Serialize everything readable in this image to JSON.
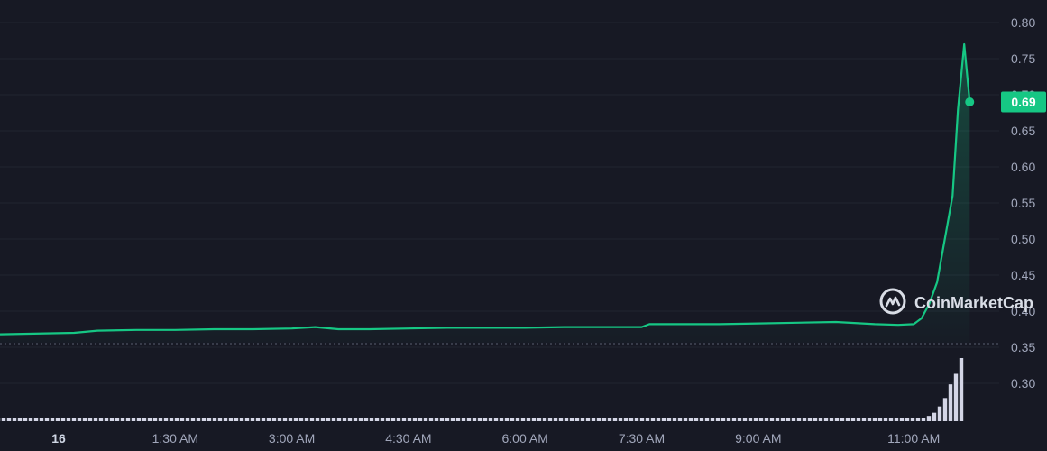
{
  "chart_data": {
    "type": "line",
    "y_ticks": [
      "0.80",
      "0.75",
      "0.70",
      "0.65",
      "0.60",
      "0.55",
      "0.50",
      "0.45",
      "0.40",
      "0.35",
      "0.30"
    ],
    "ylim": [
      0.25,
      0.82
    ],
    "x_ticks": [
      "16",
      "1:30 AM",
      "3:00 AM",
      "4:30 AM",
      "6:00 AM",
      "7:30 AM",
      "9:00 AM",
      "11:00 AM"
    ],
    "x_tick_hours": [
      0,
      1.5,
      3,
      4.5,
      6,
      7.5,
      9,
      11
    ],
    "series": [
      {
        "hours": [
          0,
          0.2,
          0.5,
          1,
          1.5,
          2,
          2.5,
          3,
          3.3,
          3.6,
          4,
          4.5,
          5,
          5.5,
          6,
          6.5,
          7,
          7.5,
          7.6,
          8,
          8.5,
          9,
          9.5,
          10,
          10.5,
          10.8,
          11,
          11.1,
          11.2,
          11.3,
          11.4,
          11.5,
          11.57,
          11.65,
          11.72
        ],
        "values": [
          0.368,
          0.37,
          0.373,
          0.374,
          0.374,
          0.375,
          0.375,
          0.376,
          0.378,
          0.375,
          0.375,
          0.376,
          0.377,
          0.377,
          0.377,
          0.378,
          0.378,
          0.378,
          0.382,
          0.382,
          0.382,
          0.383,
          0.384,
          0.385,
          0.382,
          0.381,
          0.382,
          0.39,
          0.41,
          0.44,
          0.5,
          0.56,
          0.68,
          0.77,
          0.69
        ]
      }
    ],
    "volume": [
      1,
      1,
      1,
      1,
      1,
      1,
      1,
      1,
      1,
      1,
      1,
      1,
      1,
      1,
      1,
      1,
      1,
      1,
      1,
      1,
      1,
      1,
      1,
      1,
      1,
      1,
      1,
      1,
      1,
      1,
      1,
      1,
      1,
      1,
      1,
      1,
      1,
      1,
      1,
      1,
      1,
      1,
      1,
      1,
      1,
      1,
      1,
      1,
      1,
      1,
      1,
      1,
      1,
      1,
      1,
      1,
      1,
      1,
      1,
      1,
      1,
      1,
      1,
      1,
      1,
      1,
      1,
      1,
      1,
      1,
      1,
      1,
      1,
      1,
      1,
      1,
      1,
      1,
      1,
      1,
      1,
      1,
      1,
      1,
      1,
      1,
      1,
      1,
      1,
      1,
      1,
      1,
      1,
      1,
      1,
      1,
      1,
      1,
      1,
      1,
      1,
      1,
      1,
      1,
      1,
      1,
      1,
      1,
      1,
      1,
      1,
      1,
      1,
      1,
      1,
      1,
      1,
      1,
      1,
      1,
      1,
      1,
      1,
      1,
      1,
      1,
      1,
      1,
      1,
      1,
      1,
      1,
      1,
      1,
      1,
      1,
      1,
      1,
      1,
      1,
      1,
      1,
      1,
      1,
      1,
      1,
      1,
      1,
      1,
      1,
      1,
      1,
      1,
      1,
      1,
      1,
      1,
      1,
      1,
      1,
      1,
      1,
      1,
      1,
      1,
      1,
      1,
      1,
      1,
      1,
      1,
      1,
      2,
      3,
      5,
      8,
      14,
      22,
      35,
      45,
      60
    ],
    "last_price": "0.69",
    "reference_price": 0.355,
    "grid": true,
    "colors": {
      "background": "#171924",
      "line": "#16c784",
      "grid": "#222531",
      "volume": "#d4d6e6",
      "badge": "#16c784",
      "axis_text": "#a1a7bb"
    }
  },
  "watermark": {
    "text": "CoinMarketCap",
    "icon": "coinmarketcap-logo-icon"
  }
}
